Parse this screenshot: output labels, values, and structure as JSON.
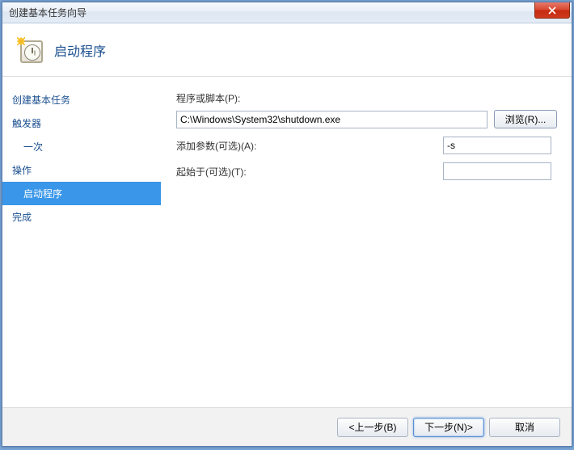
{
  "window": {
    "title": "创建基本任务向导"
  },
  "header": {
    "title": "启动程序"
  },
  "sidebar": {
    "items": [
      {
        "label": "创建基本任务",
        "child": false,
        "active": false
      },
      {
        "label": "触发器",
        "child": false,
        "active": false
      },
      {
        "label": "一次",
        "child": true,
        "active": false
      },
      {
        "label": "操作",
        "child": false,
        "active": false
      },
      {
        "label": "启动程序",
        "child": true,
        "active": true
      },
      {
        "label": "完成",
        "child": false,
        "active": false
      }
    ]
  },
  "form": {
    "program_label": "程序或脚本(P):",
    "program_value": "C:\\Windows\\System32\\shutdown.exe",
    "browse_label": "浏览(R)...",
    "args_label": "添加参数(可选)(A):",
    "args_value": "-s ",
    "startin_label": "起始于(可选)(T):",
    "startin_value": ""
  },
  "footer": {
    "back": "<上一步(B)",
    "next": "下一步(N)>",
    "cancel": "取消"
  }
}
